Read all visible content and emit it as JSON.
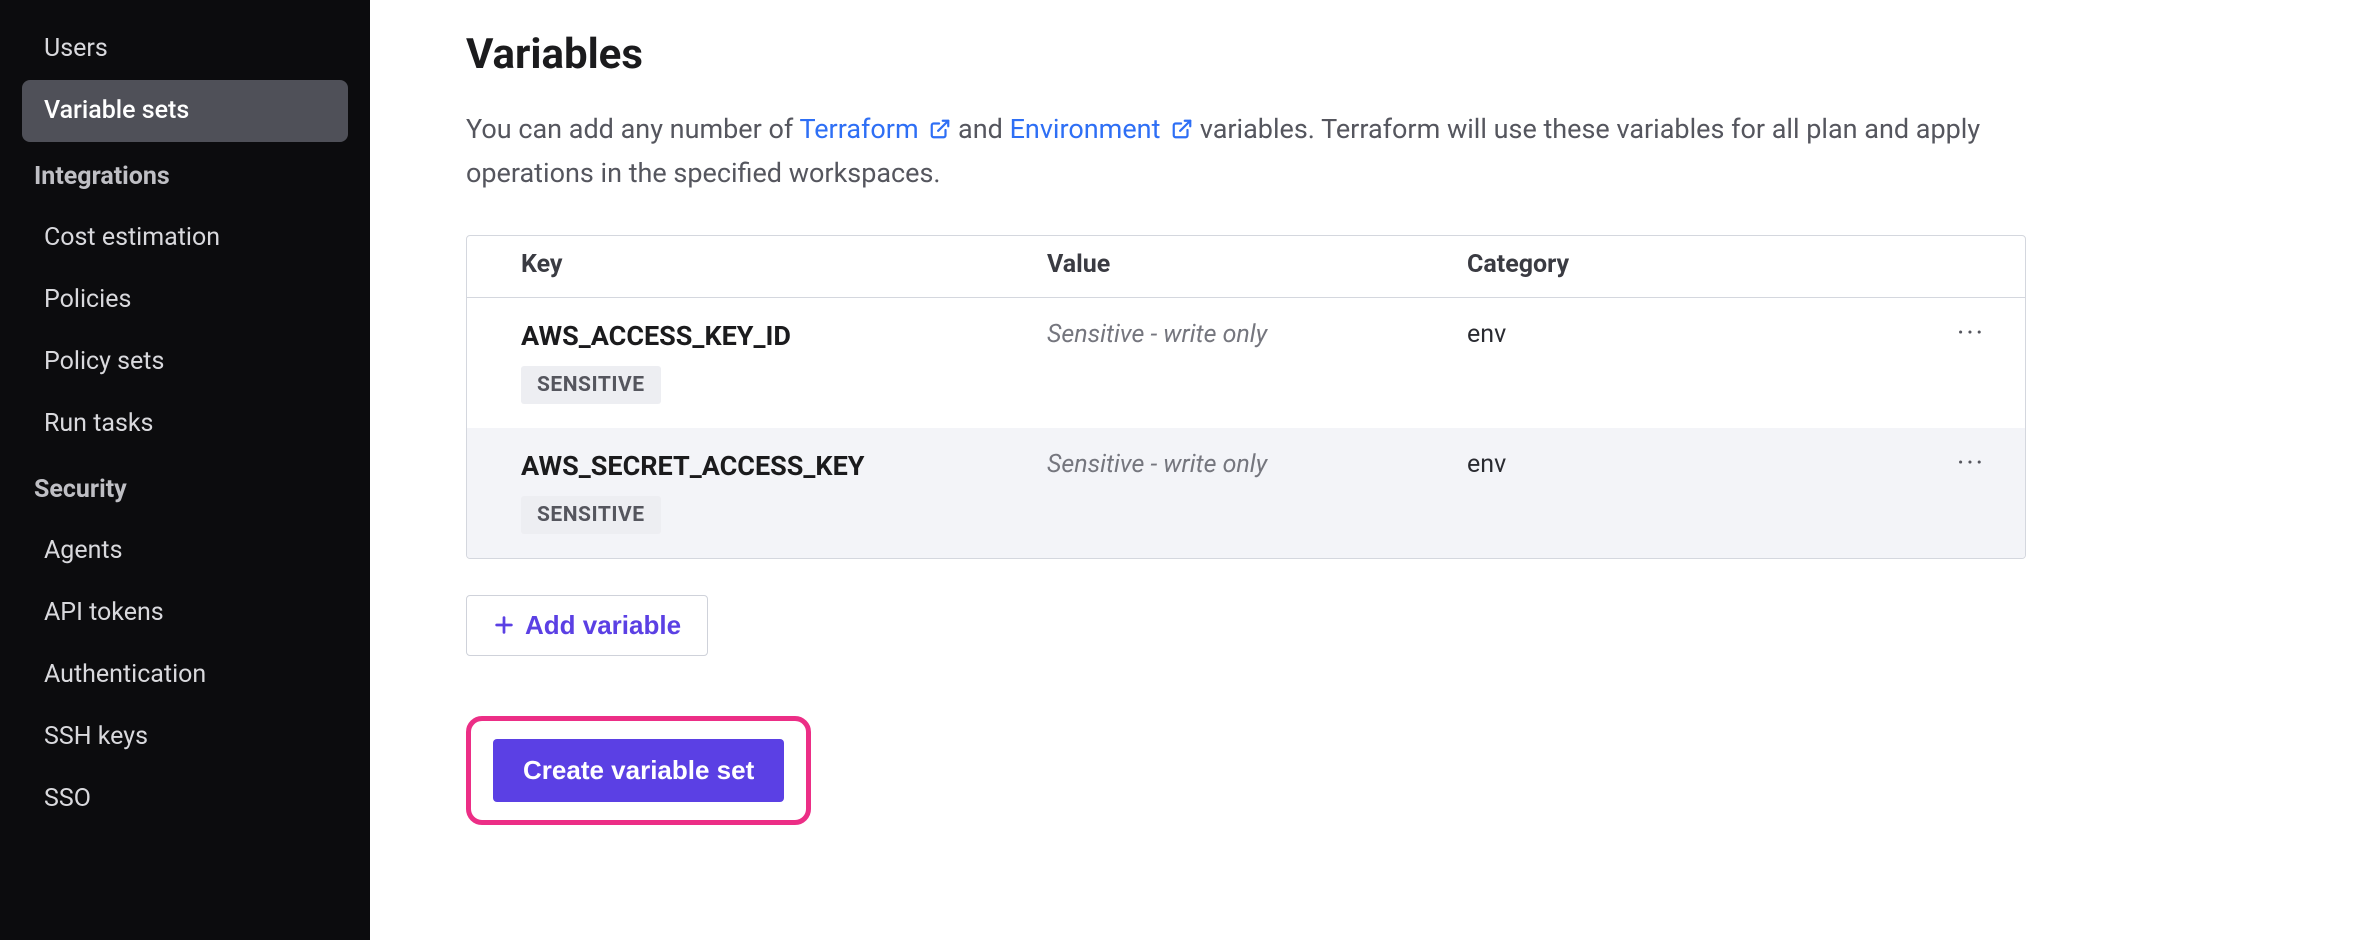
{
  "sidebar": {
    "items": [
      {
        "label": "Users",
        "type": "link",
        "active": false
      },
      {
        "label": "Variable sets",
        "type": "link",
        "active": true
      },
      {
        "label": "Integrations",
        "type": "heading"
      },
      {
        "label": "Cost estimation",
        "type": "link",
        "active": false
      },
      {
        "label": "Policies",
        "type": "link",
        "active": false
      },
      {
        "label": "Policy sets",
        "type": "link",
        "active": false
      },
      {
        "label": "Run tasks",
        "type": "link",
        "active": false
      },
      {
        "label": "Security",
        "type": "heading"
      },
      {
        "label": "Agents",
        "type": "link",
        "active": false
      },
      {
        "label": "API tokens",
        "type": "link",
        "active": false
      },
      {
        "label": "Authentication",
        "type": "link",
        "active": false
      },
      {
        "label": "SSH keys",
        "type": "link",
        "active": false
      },
      {
        "label": "SSO",
        "type": "link",
        "active": false
      }
    ]
  },
  "page": {
    "title": "Variables",
    "intro_pre": "You can add any number of ",
    "intro_link1": "Terraform",
    "intro_mid": " and ",
    "intro_link2": "Environment",
    "intro_post": " variables. Terraform will use these variables for all plan and apply operations in the specified workspaces."
  },
  "table": {
    "headers": {
      "key": "Key",
      "value": "Value",
      "category": "Category"
    },
    "sensitive_badge": "SENSITIVE",
    "rows": [
      {
        "key": "AWS_ACCESS_KEY_ID",
        "value": "Sensitive - write only",
        "category": "env",
        "sensitive": true
      },
      {
        "key": "AWS_SECRET_ACCESS_KEY",
        "value": "Sensitive - write only",
        "category": "env",
        "sensitive": true
      }
    ]
  },
  "buttons": {
    "add_variable": "Add variable",
    "create_set": "Create variable set"
  },
  "colors": {
    "accent": "#5b40e4",
    "link": "#2e6ff5",
    "highlight_border": "#ec2e86",
    "sidebar_bg": "#0c0c0e"
  }
}
